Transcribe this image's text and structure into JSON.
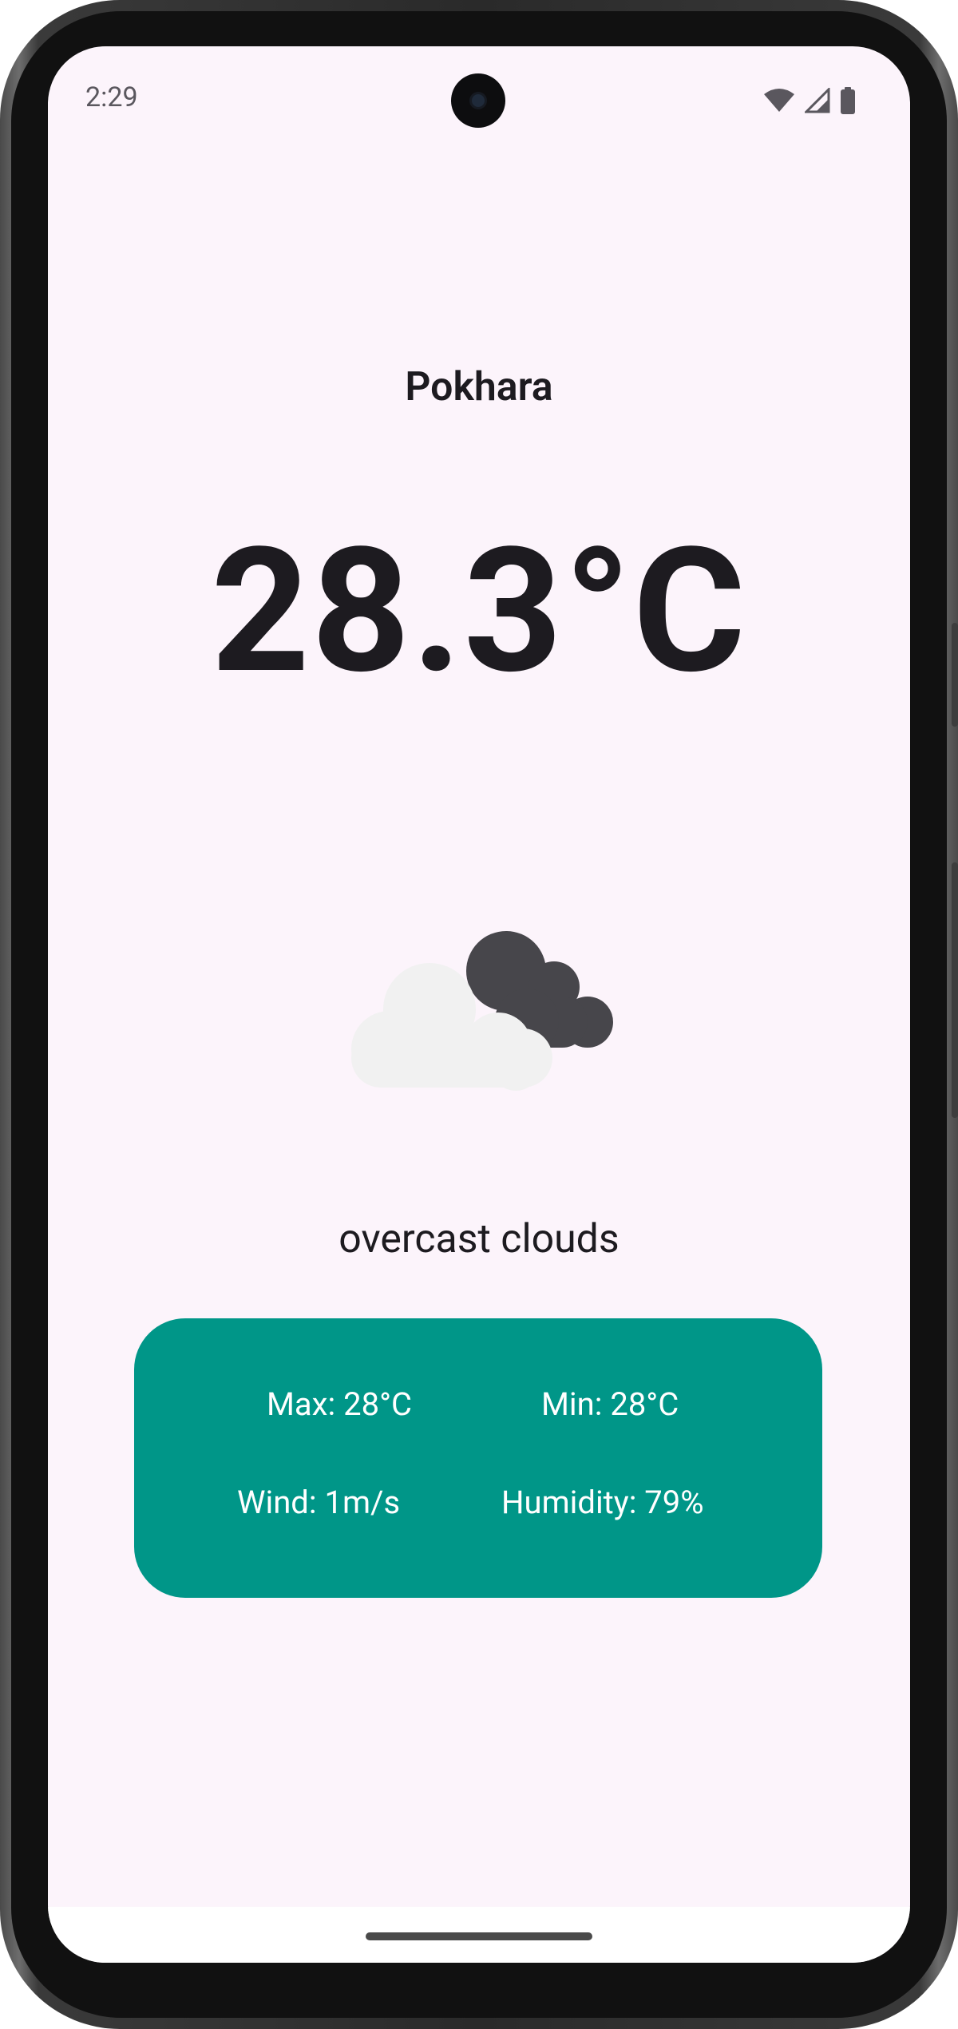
{
  "status_bar": {
    "time": "2:29",
    "icons": [
      "wifi-icon",
      "signal-icon",
      "battery-icon"
    ]
  },
  "weather": {
    "city": "Pokhara",
    "temperature": "28.3°C",
    "condition_icon": "overcast-clouds-icon",
    "description": "overcast clouds"
  },
  "stats": {
    "max": "Max: 28°C",
    "min": "Min: 28°C",
    "wind": "Wind: 1m/s",
    "humidity": "Humidity: 79%"
  },
  "colors": {
    "background": "#fcf4fb",
    "card": "#009688",
    "text": "#1d1b20",
    "card_text": "#ffffff"
  }
}
